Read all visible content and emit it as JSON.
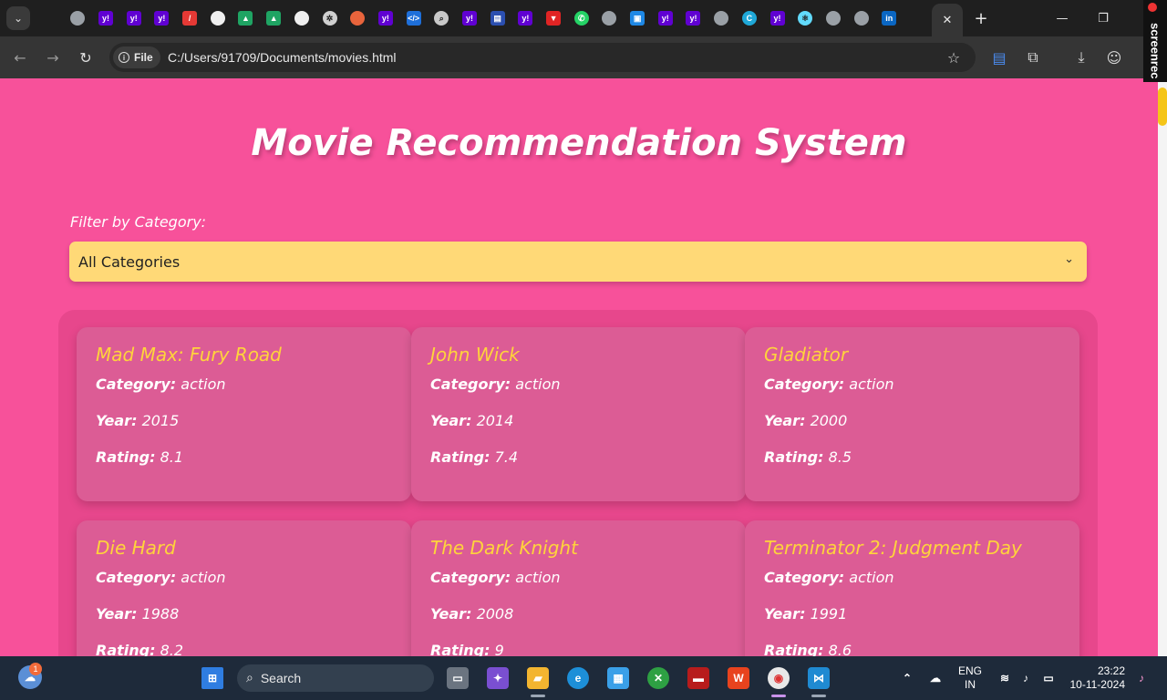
{
  "browser": {
    "address_chip_label": "File",
    "url": "C:/Users/91709/Documents/movies.html",
    "overlay_label": "screenrec"
  },
  "tab_favicons": [
    {
      "icon": "globe-icon",
      "color": "#9aa0a6",
      "glyph": "",
      "round": true
    },
    {
      "icon": "yahoo-icon",
      "color": "#6001d2",
      "glyph": "y!",
      "round": false
    },
    {
      "icon": "yahoo-icon",
      "color": "#6001d2",
      "glyph": "y!",
      "round": false
    },
    {
      "icon": "yahoo-icon",
      "color": "#6001d2",
      "glyph": "y!",
      "round": false
    },
    {
      "icon": "slash-icon",
      "color": "#e53935",
      "glyph": "/",
      "round": false
    },
    {
      "icon": "github-icon",
      "color": "#f0f0f0",
      "glyph": "",
      "round": true
    },
    {
      "icon": "drive-icon",
      "color": "#1fa463",
      "glyph": "▲",
      "round": false
    },
    {
      "icon": "drive-icon",
      "color": "#1fa463",
      "glyph": "▲",
      "round": false
    },
    {
      "icon": "github-icon",
      "color": "#f0f0f0",
      "glyph": "",
      "round": true
    },
    {
      "icon": "openai-icon",
      "color": "#d0d0d0",
      "glyph": "✲",
      "round": true
    },
    {
      "icon": "helmet-icon",
      "color": "#e8643c",
      "glyph": "",
      "round": true
    },
    {
      "icon": "yahoo-icon",
      "color": "#6001d2",
      "glyph": "y!",
      "round": false
    },
    {
      "icon": "code-icon",
      "color": "#1e6fd9",
      "glyph": "</>",
      "round": false
    },
    {
      "icon": "magnifier-icon",
      "color": "#c9c9c9",
      "glyph": "⌕",
      "round": true
    },
    {
      "icon": "yahoo-icon",
      "color": "#6001d2",
      "glyph": "y!",
      "round": false
    },
    {
      "icon": "news-icon",
      "color": "#2b4fb0",
      "glyph": "▤",
      "round": false
    },
    {
      "icon": "yahoo-icon",
      "color": "#6001d2",
      "glyph": "y!",
      "round": false
    },
    {
      "icon": "triangle-icon",
      "color": "#e02424",
      "glyph": "▼",
      "round": false
    },
    {
      "icon": "whatsapp-icon",
      "color": "#25d366",
      "glyph": "✆",
      "round": true
    },
    {
      "icon": "globe-icon",
      "color": "#9aa0a6",
      "glyph": "",
      "round": true
    },
    {
      "icon": "image-icon",
      "color": "#1e88e5",
      "glyph": "▣",
      "round": false
    },
    {
      "icon": "yahoo-icon",
      "color": "#6001d2",
      "glyph": "y!",
      "round": false
    },
    {
      "icon": "yahoo-icon",
      "color": "#6001d2",
      "glyph": "y!",
      "round": false
    },
    {
      "icon": "globe-icon",
      "color": "#9aa0a6",
      "glyph": "",
      "round": true
    },
    {
      "icon": "canva-icon",
      "color": "#1fa8d8",
      "glyph": "C",
      "round": true
    },
    {
      "icon": "yahoo-icon",
      "color": "#6001d2",
      "glyph": "y!",
      "round": false
    },
    {
      "icon": "react-icon",
      "color": "#61dafb",
      "glyph": "⚛",
      "round": true
    },
    {
      "icon": "globe-icon",
      "color": "#9aa0a6",
      "glyph": "",
      "round": true
    },
    {
      "icon": "globe-icon",
      "color": "#9aa0a6",
      "glyph": "",
      "round": true
    },
    {
      "icon": "linkedin-icon",
      "color": "#0a66c2",
      "glyph": "in",
      "round": false
    }
  ],
  "page": {
    "title": "Movie Recommendation System",
    "filter_label": "Filter by Category:",
    "selected_category": "All Categories",
    "field_labels": {
      "category": "Category:",
      "year": "Year:",
      "rating": "Rating:"
    }
  },
  "movies": [
    {
      "title": "Mad Max: Fury Road",
      "category": "action",
      "year": "2015",
      "rating": "8.1"
    },
    {
      "title": "John Wick",
      "category": "action",
      "year": "2014",
      "rating": "7.4"
    },
    {
      "title": "Gladiator",
      "category": "action",
      "year": "2000",
      "rating": "8.5"
    },
    {
      "title": "Die Hard",
      "category": "action",
      "year": "1988",
      "rating": "8.2"
    },
    {
      "title": "The Dark Knight",
      "category": "action",
      "year": "2008",
      "rating": "9"
    },
    {
      "title": "Terminator 2: Judgment Day",
      "category": "action",
      "year": "1991",
      "rating": "8.6"
    }
  ],
  "taskbar": {
    "search_label": "Search",
    "weather_badge": "1",
    "language_line1": "ENG",
    "language_line2": "IN",
    "time": "23:22",
    "date": "10-11-2024"
  },
  "colors": {
    "page_background": "#f7519a",
    "card_title": "#ffd43b",
    "select_background": "#ffd977"
  }
}
